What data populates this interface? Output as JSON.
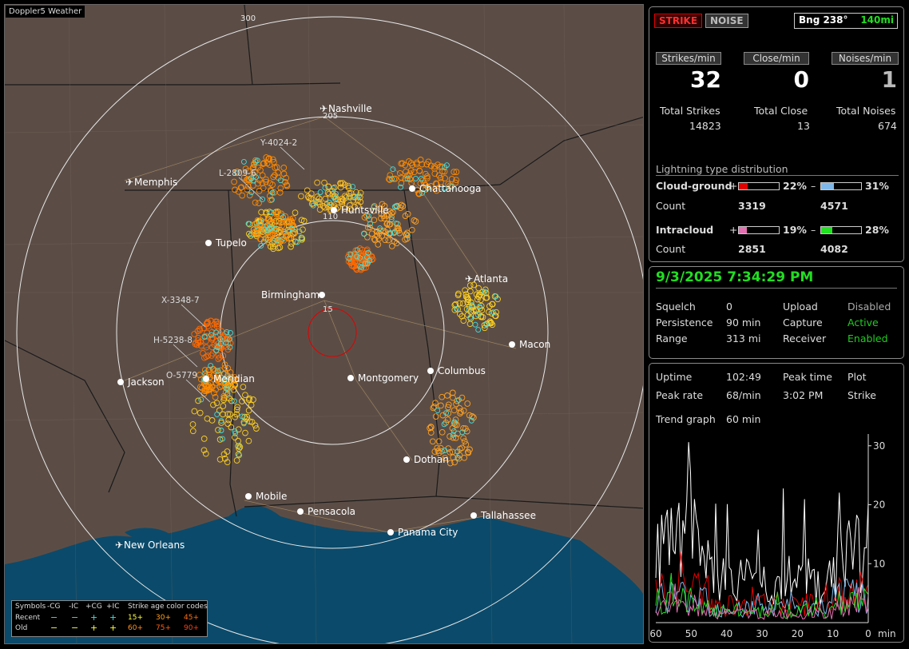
{
  "app_title": "Doppler5 Weather",
  "status_buttons": {
    "strike": "STRIKE",
    "noise": "NOISE"
  },
  "bearing": {
    "label": "Bng 238°",
    "distance": "140mi"
  },
  "rate_headers": [
    "Strikes/min",
    "Close/min",
    "Noises/min"
  ],
  "rate_values": [
    "32",
    "0",
    "1"
  ],
  "totals": [
    {
      "label": "Total Strikes",
      "value": "14823"
    },
    {
      "label": "Total Close",
      "value": "13"
    },
    {
      "label": "Total Noises",
      "value": "674"
    }
  ],
  "distribution": {
    "title": "Lightning type distribution",
    "cloud_ground": {
      "label": "Cloud-ground",
      "pos_pct": "22%",
      "neg_pct": "31%",
      "pos_fill": 0.22,
      "neg_fill": 0.31,
      "count_label": "Count",
      "pos_count": "3319",
      "neg_count": "4571",
      "pos_color": "#e00000",
      "neg_color": "#7fb8e8"
    },
    "intracloud": {
      "label": "Intracloud",
      "pos_pct": "19%",
      "neg_pct": "28%",
      "pos_fill": 0.19,
      "neg_fill": 0.28,
      "count_label": "Count",
      "pos_count": "2851",
      "neg_count": "4082",
      "pos_color": "#e070b0",
      "neg_color": "#22e022"
    },
    "plus": "+",
    "minus": "–"
  },
  "datetime": "9/3/2025 7:34:29 PM",
  "settings": [
    {
      "label": "Squelch",
      "value": "0",
      "label2": "Upload",
      "value2": "Disabled",
      "green2": false
    },
    {
      "label": "Persistence",
      "value": "90 min",
      "label2": "Capture",
      "value2": "Active",
      "green2": true
    },
    {
      "label": "Range",
      "value": "313 mi",
      "label2": "Receiver",
      "value2": "Enabled",
      "green2": true
    }
  ],
  "stats": {
    "uptime_label": "Uptime",
    "uptime": "102:49",
    "peak_time_label": "Peak time",
    "peak_time": "3:02 PM",
    "plot_label": "Plot",
    "plot_value": "Strike",
    "peak_rate_label": "Peak rate",
    "peak_rate": "68/min",
    "trend_label": "Trend graph",
    "trend_value": "60 min"
  },
  "trend_chart": {
    "x_ticks": [
      "60",
      "50",
      "40",
      "30",
      "20",
      "10",
      "0"
    ],
    "x_unit": "min",
    "y_ticks": [
      "30",
      "20",
      "10"
    ]
  },
  "map": {
    "range_labels": [
      "300",
      "205",
      "110",
      "15"
    ],
    "cities": [
      {
        "name": "Nashville",
        "airport": true
      },
      {
        "name": "Memphis",
        "airport": true
      },
      {
        "name": "Chattanooga",
        "airport": false
      },
      {
        "name": "Huntsville",
        "airport": false
      },
      {
        "name": "Tupelo",
        "airport": false
      },
      {
        "name": "Atlanta",
        "airport": true
      },
      {
        "name": "Birmingham",
        "airport": false
      },
      {
        "name": "Macon",
        "airport": false
      },
      {
        "name": "Jackson",
        "airport": false
      },
      {
        "name": "Meridian",
        "airport": false
      },
      {
        "name": "Montgomery",
        "airport": false
      },
      {
        "name": "Columbus",
        "airport": false
      },
      {
        "name": "Dothan",
        "airport": false
      },
      {
        "name": "Mobile",
        "airport": false
      },
      {
        "name": "Pensacola",
        "airport": false
      },
      {
        "name": "Tallahassee",
        "airport": false
      },
      {
        "name": "Panama City",
        "airport": false
      },
      {
        "name": "New Orleans",
        "airport": true
      }
    ],
    "storm_labels": [
      "Y-4024-2",
      "L-2809-6",
      "X-3348-7",
      "H-5238-8",
      "O-5779"
    ],
    "water_color": "#0b4a6a",
    "land_color": "#5b4d46"
  },
  "legend": {
    "symbols_title": "Symbols",
    "cols": [
      "-CG",
      "-IC",
      "+CG",
      "+IC"
    ],
    "age_title": "Strike age color codes",
    "recent_label": "Recent",
    "old_label": "Old",
    "recent_ages": [
      "15+",
      "30+",
      "45+"
    ],
    "old_ages": [
      "60+",
      "75+",
      "90+"
    ],
    "recent_age_colors": [
      "#ffff40",
      "#ffa020",
      "#ff7010"
    ],
    "old_age_colors": [
      "#ff9020",
      "#ff6010",
      "#ff4010"
    ],
    "minus_glyph": "−",
    "plus_glyph": "+"
  }
}
